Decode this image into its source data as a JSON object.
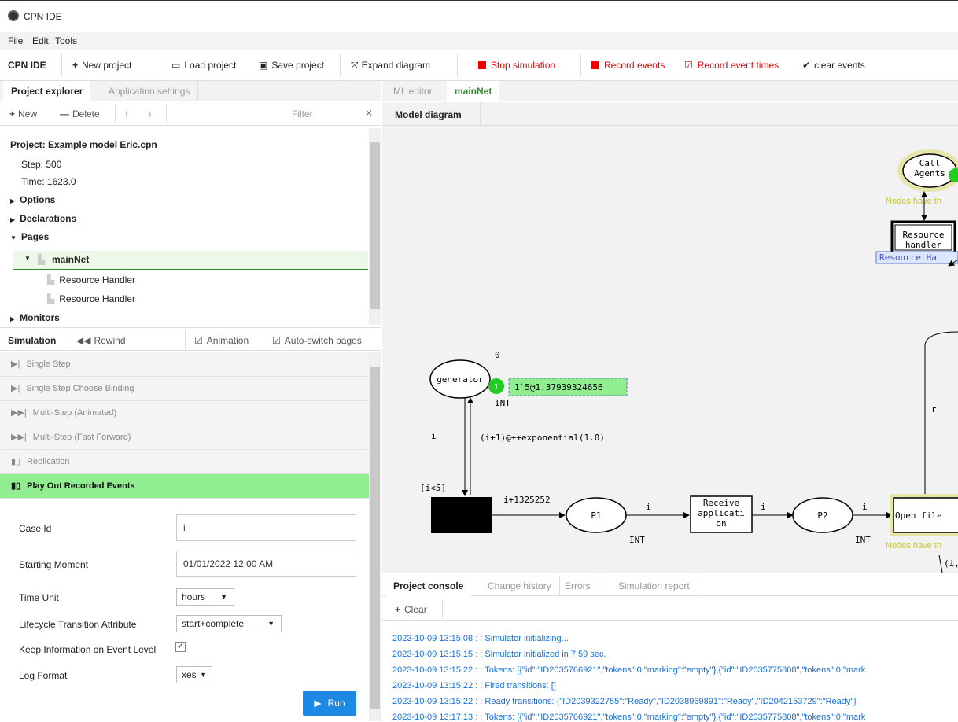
{
  "window": {
    "title": "CPN IDE"
  },
  "menu": [
    "File",
    "Edit",
    "Tools"
  ],
  "toolbar": {
    "brand": "CPN IDE",
    "new_project": "New project",
    "load_project": "Load project",
    "save_project": "Save project",
    "expand_diagram": "Expand diagram",
    "stop_simulation": "Stop simulation",
    "record_events": "Record events",
    "record_event_times": "Record event times",
    "clear_events": "clear events"
  },
  "left_tabs": {
    "explorer": "Project explorer",
    "settings": "Application settings"
  },
  "explorer_toolbar": {
    "new": "New",
    "delete": "Delete",
    "filter_placeholder": "Filter"
  },
  "project": {
    "title": "Project: Example model Eric.cpn",
    "step": "Step: 500",
    "time": "Time: 1623.0",
    "options": "Options",
    "declarations": "Declarations",
    "pages": "Pages",
    "main_page": "mainNet",
    "sub1": "Resource Handler",
    "sub2": "Resource Handler",
    "monitors": "Monitors"
  },
  "simulation": {
    "tab": "Simulation",
    "rewind": "Rewind",
    "animation": "Animation",
    "auto_switch": "Auto-switch pages",
    "items": [
      "Single Step",
      "Single Step Choose Binding",
      "Multi-Step (Animated)",
      "Multi-Step (Fast Forward)",
      "Replication",
      "Play Out Recorded Events"
    ]
  },
  "playout": {
    "case_id_label": "Case Id",
    "case_id_value": "i",
    "starting_label": "Starting Moment",
    "starting_value": "01/01/2022 12:00 AM",
    "time_unit_label": "Time Unit",
    "time_unit_value": "hours",
    "lifecycle_label": "Lifecycle Transition Attribute",
    "lifecycle_value": "start+complete",
    "keep_info_label": "Keep Information on Event Level",
    "log_format_label": "Log Format",
    "log_format_value": "xes",
    "run": "Run"
  },
  "editor_tabs": {
    "ml": "ML editor",
    "main": "mainNet",
    "diagram": "Model diagram"
  },
  "diagram": {
    "call_agents": "Call\nAgents",
    "nodes_have": "Nodes have th",
    "resource_handler": "Resource\nhandler",
    "resource_tag": "Resource Ha",
    "zero": "0",
    "generator": "generator",
    "token_count": "1",
    "marking": "1`5@1.37939324656",
    "int1": "INT",
    "arc_i": "i",
    "arc_expr": "(i+1)@++exponential(1.0)",
    "guard": "[i<5]",
    "out_expr": "i+1325252",
    "p1": "P1",
    "arc_i2": "i",
    "int2": "INT",
    "receive": "Receive\napplicati\non",
    "arc_i3": "i",
    "p2": "P2",
    "arc_i4": "i",
    "int3": "INT",
    "open_file": "Open file",
    "nodes_have2": "Nodes have th",
    "r": "r",
    "i_partial": "(i,"
  },
  "console_tabs": {
    "console": "Project console",
    "history": "Change history",
    "errors": "Errors",
    "report": "Simulation report"
  },
  "console": {
    "clear": "Clear",
    "lines": [
      "2023-10-09 13:15:08 : : Simulator initializing...",
      "2023-10-09 13:15:15 : : Simulator initialized in 7.59 sec.",
      "2023-10-09 13:15:22 : : Tokens: [{\"id\":\"ID2035766921\",\"tokens\":0,\"marking\":\"empty\"},{\"id\":\"ID2035775808\",\"tokens\":0,\"mark",
      "2023-10-09 13:15:22 : : Fired transitions: []",
      "2023-10-09 13:15:22 : : Ready transitions: {\"ID2039322755\":\"Ready\",\"ID2038969891\":\"Ready\",\"ID2042153729\":\"Ready\"}",
      "2023-10-09 13:17:13 : : Tokens: [{\"id\":\"ID2035766921\",\"tokens\":0,\"marking\":\"empty\"},{\"id\":\"ID2035775808\",\"tokens\":0,\"mark"
    ]
  }
}
